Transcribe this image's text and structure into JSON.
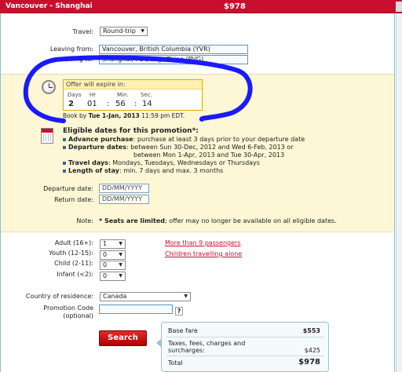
{
  "title": {
    "route": "Vancouver - Shanghai",
    "price": "$978"
  },
  "travel": {
    "label": "Travel:",
    "value": "Round-trip"
  },
  "leaving": {
    "label": "Leaving from:",
    "value": "Vancouver, British Columbia (YVR)"
  },
  "going": {
    "label": "Going to:",
    "value": "Shanghai, Pu Dong, China (PVG)"
  },
  "offer": {
    "header": "Offer will expire in:",
    "labels": {
      "days": "Days",
      "hr": "Hr",
      "min": "Min.",
      "sec": "Sec."
    },
    "values": {
      "days": "2",
      "hr": "01",
      "min": "56",
      "sec": "14"
    },
    "book_by_prefix": "Book by",
    "book_by_date": "Tue 1-Jan, 2013",
    "book_by_suffix": "11:59 pm EDT."
  },
  "promotion": {
    "title": "Eligible dates for this promotion*:",
    "advance_label": "Advance purchase",
    "advance_text": ": purchase at least 3 days prior to your departure date",
    "departure_label": "Departure dates",
    "departure_text": ": between Sun 30-Dec, 2012 and Wed 6-Feb, 2013 or",
    "departure_text2": "between Mon 1-Apr, 2013 and Tue 30-Apr, 2013",
    "travel_days_label": "Travel days",
    "travel_days_text": ": Mondays, Tuesdays, Wednesdays or Thursdays",
    "length_label": "Length of stay",
    "length_text": ": min. 7 days and max. 3 months"
  },
  "dates": {
    "departure_label": "Departure date:",
    "departure_placeholder": "DD/MM/YYYY",
    "return_label": "Return date:",
    "return_placeholder": "DD/MM/YYYY"
  },
  "note": {
    "label": "Note:",
    "bold": "* Seats are limited",
    "text": "; offer may no longer be available on all eligible dates."
  },
  "passengers": {
    "adult": {
      "label": "Adult (16+):",
      "value": "1"
    },
    "youth": {
      "label": "Youth (12-15):",
      "value": "0"
    },
    "child": {
      "label": "Child (2-11):",
      "value": "0"
    },
    "infant": {
      "label": "Infant (<2):",
      "value": "0"
    },
    "more_link": "More than 9 passengers",
    "children_link": "Children travelling alone"
  },
  "residence": {
    "label": "Country of residence:",
    "value": "Canada"
  },
  "promo_code": {
    "label": "Promotion Code",
    "sublabel": "(optional)",
    "help": "?"
  },
  "search_label": "Search",
  "fare": {
    "base_label": "Base fare",
    "base_value": "$553",
    "taxes_label_1": "Taxes, fees, charges and",
    "taxes_label_2": "surcharges:",
    "taxes_value": "$425",
    "total_label": "Total",
    "total_value": "$978"
  },
  "colors": {
    "brand": "#c8102e",
    "highlight": "#fdf7d6",
    "annotation": "#1a1aff"
  }
}
